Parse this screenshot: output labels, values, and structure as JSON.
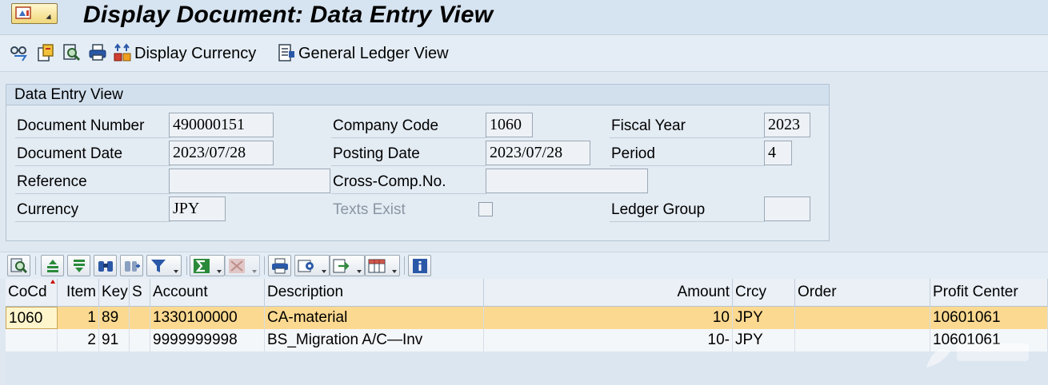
{
  "title": "Display Document: Data Entry View",
  "toolbar": {
    "display_currency_label": "Display Currency",
    "general_ledger_view_label": "General Ledger View"
  },
  "group": {
    "title": "Data Entry View",
    "document_number_label": "Document Number",
    "document_number": "490000151",
    "company_code_label": "Company Code",
    "company_code": "1060",
    "fiscal_year_label": "Fiscal Year",
    "fiscal_year": "2023",
    "document_date_label": "Document Date",
    "document_date": "2023/07/28",
    "posting_date_label": "Posting Date",
    "posting_date": "2023/07/28",
    "period_label": "Period",
    "period": "4",
    "reference_label": "Reference",
    "reference": "",
    "cross_comp_label": "Cross-Comp.No.",
    "cross_comp": "",
    "currency_label": "Currency",
    "currency": "JPY",
    "texts_exist_label": "Texts Exist",
    "ledger_group_label": "Ledger Group",
    "ledger_group": ""
  },
  "grid": {
    "columns": [
      "CoCd",
      "Item",
      "Key",
      "S",
      "Account",
      "Description",
      "Amount",
      "Crcy",
      "Order",
      "Profit Center"
    ],
    "rows": [
      {
        "cocd": "1060",
        "item": "1",
        "key": "89",
        "s": "",
        "account": "1330100000",
        "description": "CA-material",
        "amount": "10",
        "crcy": "JPY",
        "order": "",
        "profit_center": "10601061"
      },
      {
        "cocd": "",
        "item": "2",
        "key": "91",
        "s": "",
        "account": "9999999998",
        "description": "BS_Migration A/C—Inv",
        "amount": "10-",
        "crcy": "JPY",
        "order": "",
        "profit_center": "10601061"
      }
    ]
  },
  "colors": {
    "selected_row": "#fbd990",
    "background": "#dfe8f1"
  }
}
